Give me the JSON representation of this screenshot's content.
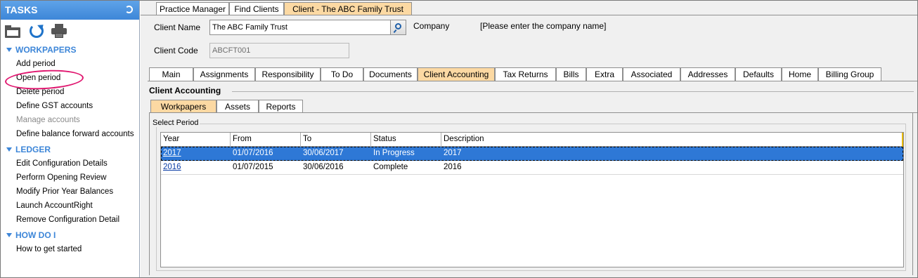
{
  "tasks_pane": {
    "title": "TASKS",
    "sections": [
      {
        "title": "WORKPAPERS",
        "items": [
          {
            "label": "Add period",
            "enabled": true
          },
          {
            "label": "Open period",
            "enabled": true
          },
          {
            "label": "Delete period",
            "enabled": true
          },
          {
            "label": "Define GST accounts",
            "enabled": true
          },
          {
            "label": "Manage accounts",
            "enabled": false
          },
          {
            "label": "Define balance forward accounts",
            "enabled": true
          }
        ]
      },
      {
        "title": "LEDGER",
        "items": [
          {
            "label": "Edit Configuration Details",
            "enabled": true
          },
          {
            "label": "Perform Opening Review",
            "enabled": true
          },
          {
            "label": "Modify Prior Year Balances",
            "enabled": true
          },
          {
            "label": "Launch AccountRight",
            "enabled": true
          },
          {
            "label": "Remove Configuration Detail",
            "enabled": true
          }
        ]
      },
      {
        "title": "HOW DO I",
        "items": [
          {
            "label": "How to get started",
            "enabled": true
          }
        ]
      }
    ]
  },
  "top_tabs": [
    "Practice Manager",
    "Find Clients",
    "Client - The ABC Family Trust"
  ],
  "client": {
    "name_label": "Client Name",
    "name_value": "The ABC Family Trust",
    "company_label": "Company",
    "company_value": "[Please enter the company name]",
    "code_label": "Client Code",
    "code_value": "ABCFT001"
  },
  "client_tabs": [
    "Main",
    "Assignments",
    "Responsibility",
    "To Do",
    "Documents",
    "Client Accounting",
    "Tax Returns",
    "Bills",
    "Extra",
    "Associated",
    "Addresses",
    "Defaults",
    "Home",
    "Billing Group"
  ],
  "section_title": "Client Accounting",
  "accounting_tabs": [
    "Workpapers",
    "Assets",
    "Reports"
  ],
  "select_period_label": "Select Period",
  "grid": {
    "columns": [
      "Year",
      "From",
      "To",
      "Status",
      "Description"
    ],
    "rows": [
      {
        "year": "2017",
        "from": "01/07/2016",
        "to": "30/06/2017",
        "status": "In Progress",
        "description": "2017"
      },
      {
        "year": "2016",
        "from": "01/07/2015",
        "to": "30/06/2016",
        "status": "Complete",
        "description": "2016"
      }
    ]
  },
  "colors": {
    "header_blue": "#3d86d8",
    "active_tab": "#fcd9a3",
    "selection": "#2e78d6",
    "annotation_ring": "#e0166f"
  }
}
